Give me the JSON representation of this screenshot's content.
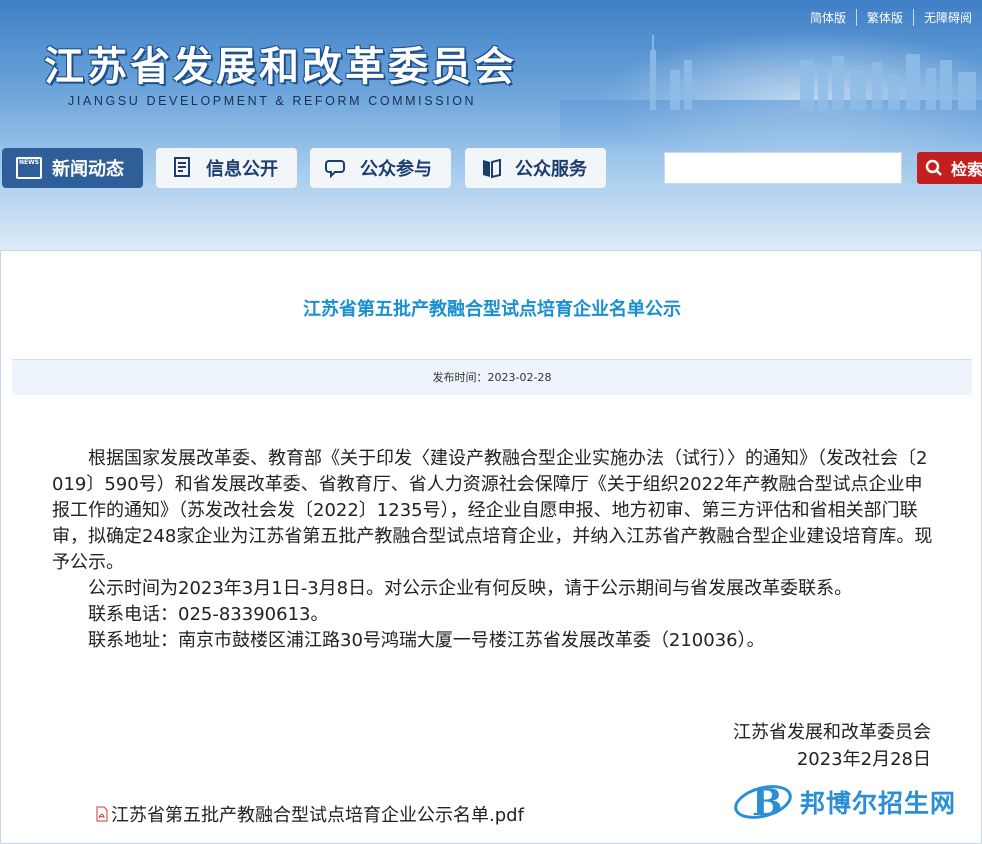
{
  "header": {
    "site_title": "江苏省发展和改革委员会",
    "site_subtitle": "JIANGSU DEVELOPMENT & REFORM COMMISSION",
    "top_links": [
      "简体版",
      "繁体版",
      "无障碍阅"
    ]
  },
  "nav": {
    "items": [
      {
        "label": "新闻动态",
        "icon": "news-icon"
      },
      {
        "label": "信息公开",
        "icon": "document-icon"
      },
      {
        "label": "公众参与",
        "icon": "chat-icon"
      },
      {
        "label": "公众服务",
        "icon": "book-icon"
      }
    ],
    "news_icon_text": "NEWS"
  },
  "search": {
    "placeholder": "",
    "button_label": "检索"
  },
  "article": {
    "title": "江苏省第五批产教融合型试点培育企业名单公示",
    "publish_label": "发布时间：",
    "publish_date": "2023-02-28",
    "paragraphs": [
      "根据国家发展改革委、教育部《关于印发〈建设产教融合型企业实施办法（试行）〉的通知》（发改社会〔2019〕590号）和省发展改革委、省教育厅、省人力资源社会保障厅《关于组织2022年产教融合型试点企业申报工作的通知》（苏发改社会发〔2022〕1235号），经企业自愿申报、地方初审、第三方评估和省相关部门联审，拟确定248家企业为江苏省第五批产教融合型试点培育企业，并纳入江苏省产教融合型企业建设培育库。现予公示。",
      "公示时间为2023年3月1日-3月8日。对公示企业有何反映，请于公示期间与省发展改革委联系。",
      "联系电话：025-83390613。",
      "联系地址：南京市鼓楼区浦江路30号鸿瑞大厦一号楼江苏省发展改革委（210036）。"
    ],
    "signature_org": "江苏省发展和改革委员会",
    "signature_date": "2023年2月28日",
    "attachment": "江苏省第五批产教融合型试点培育企业公示名单.pdf"
  },
  "watermark": {
    "logo_letter": "B",
    "text": "邦博尔招生网"
  },
  "colors": {
    "title_blue": "#1a8fd0",
    "nav_active": "#2e5f99",
    "search_red": "#c41e1e"
  }
}
